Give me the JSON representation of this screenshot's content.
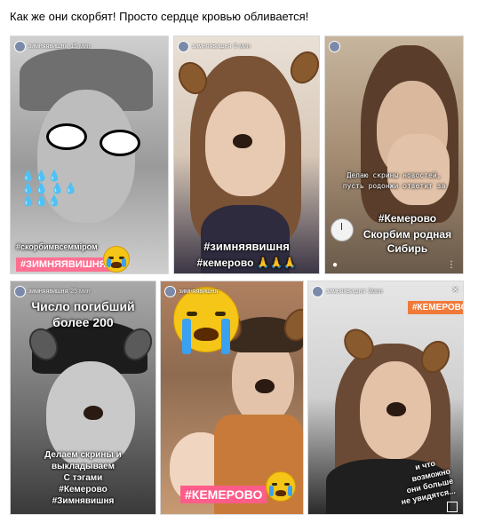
{
  "post": {
    "text": "Как же они скорбят! Просто сердце кровью обливается!"
  },
  "stories": [
    {
      "user": "зимняявишня",
      "time": "15 мин",
      "captions": [
        "#скорбимвсемміром",
        "#ЗИМНЯЯВИШНЯ"
      ]
    },
    {
      "user": "зимняявишня",
      "time": "5 мин",
      "captions": [
        "#зимняявишня",
        "#кемерово 🙏🙏🙏"
      ]
    },
    {
      "user": "",
      "time": "",
      "captions": [
        "Делаю скрины новостей,",
        "пусть родонжи ответит за",
        "#Кемерово",
        "Скорбим родная",
        "Сибирь"
      ]
    },
    {
      "user": "зимняявишня",
      "time": "25 мин",
      "captions": [
        "Число погибший",
        "более 200",
        "Делаем скрины и",
        "выкладываем",
        "С тэгами",
        "#Кемерово",
        "#Зимнявишня"
      ]
    },
    {
      "user": "зимняявишня",
      "time": "",
      "captions": [
        "#КЕМЕРОВО"
      ]
    },
    {
      "user": "зимняявишня",
      "time": "3мин",
      "captions": [
        "#КЕМЕРОВО",
        "и что",
        "возможно",
        "они больше",
        "не увидятся..."
      ]
    }
  ],
  "icons": {
    "close": "close-icon",
    "camera": "camera-icon",
    "more": "more-icon",
    "send": "send-icon"
  },
  "colors": {
    "pink_tag": "#ff6f91",
    "pink_tag_alt": "#ff5c8a",
    "orange_tag": "#f07a3a"
  }
}
